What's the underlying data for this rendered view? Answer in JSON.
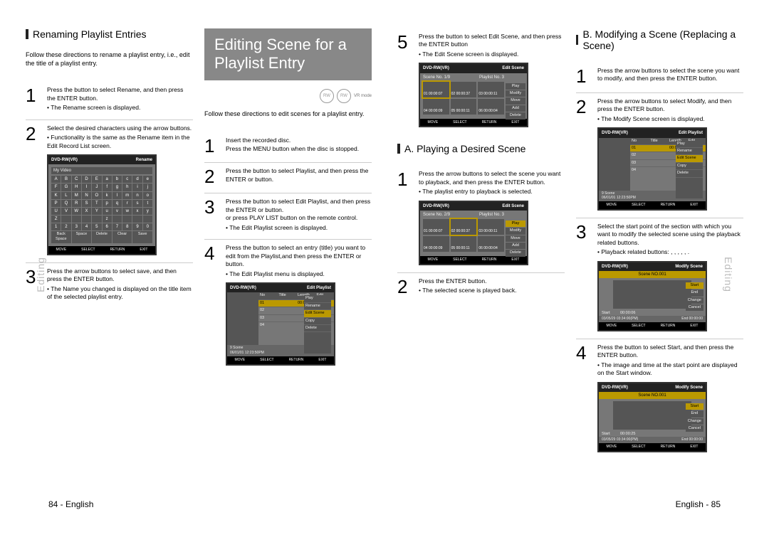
{
  "left": {
    "tab": "Editing",
    "h_rename": "Renaming Playlist Entries",
    "lead_rename": "Follow these directions to rename a playlist entry, i.e., edit the title of a playlist entry.",
    "s1": "Press the       button to select Rename, and then press the ENTER button.",
    "s1n": "The Rename screen is displayed.",
    "s2": "Select the desired characters using the arrow buttons.",
    "s2n": "Functionality is the same as the Rename item in the Edit Record List screen.",
    "s3": "Press the arrow buttons to select save, and then press the ENTER button.",
    "s3n": "The Name you changed is displayed on the title item of the selected playlist entry.",
    "shot_rename_title": "Rename",
    "shot_rename_disc": "DVD-RW(VR)",
    "shot_rename_field": "My Video",
    "kb_row": [
      "A",
      "B",
      "C",
      "D",
      "E",
      "a",
      "b",
      "c",
      "d",
      "e"
    ],
    "kb_row2": [
      "F",
      "G",
      "H",
      "I",
      "J",
      "f",
      "g",
      "h",
      "i",
      "j"
    ],
    "kb_row3": [
      "K",
      "L",
      "M",
      "N",
      "O",
      "k",
      "l",
      "m",
      "n",
      "o"
    ],
    "kb_row4": [
      "P",
      "Q",
      "R",
      "S",
      "T",
      "p",
      "q",
      "r",
      "s",
      "t"
    ],
    "kb_row5": [
      "U",
      "V",
      "W",
      "X",
      "Y",
      "u",
      "v",
      "w",
      "x",
      "y"
    ],
    "kb_row6": [
      "Z",
      " ",
      " ",
      " ",
      " ",
      "z",
      " ",
      " ",
      " ",
      " "
    ],
    "kb_nums": [
      "1",
      "2",
      "3",
      "4",
      "5",
      "6",
      "7",
      "8",
      "9",
      "0"
    ],
    "kb_fn": [
      "Back Space",
      "Space",
      "Delete",
      "Clear",
      "Save"
    ],
    "foot": [
      "MOVE",
      "SELECT",
      "RETURN",
      "EXIT"
    ],
    "bigtitle": "Editing Scene for a Playlist Entry",
    "vrmode": "VR mode",
    "lead_edit": "Follow these directions to edit scenes for a playlist entry.",
    "e1": "Insert the recorded disc.\nPress the MENU button when the disc is stopped.",
    "e2": "Press the       button to select Playlist, and then press the ENTER or  button.",
    "e3": "Press the       button to select Edit Playlist, and then press the ENTER or  button.\nor press PLAY LIST button on the remote control.",
    "e3n": "The Edit Playlist screen is displayed.",
    "e4": "Press the       button to select an entry (title) you want to edit from the Playlist,and then press the ENTER or  button.",
    "e4n": "The Edit Playlist menu is displayed.",
    "playlist": {
      "disc": "DVD-RW(VR)",
      "title": "Edit Playlist",
      "hdr": [
        "No",
        "Title",
        "Length",
        "Edit"
      ],
      "rows": [
        [
          "01",
          "",
          "00:00:07",
          ""
        ],
        [
          "02",
          "",
          "",
          ""
        ],
        [
          "03",
          "",
          "",
          ""
        ],
        [
          "04",
          "",
          "",
          ""
        ]
      ],
      "info": "9 Scene\n06/01/01 12:23:50PM",
      "menu": [
        "Play",
        "Rename",
        "Edit Scene",
        "Copy",
        "Delete"
      ]
    },
    "footer": "84 - English"
  },
  "right": {
    "tab": "Editing",
    "r5": "Press the       button to select Edit Scene, and then press the ENTER button",
    "r5n": "The Edit Scene screen is displayed.",
    "scene": {
      "disc": "DVD-RW(VR)",
      "title": "Edit Scene",
      "sceneno": "Scene No.    1/9",
      "playlist": "Playlist No.    3",
      "btns": [
        "Play",
        "Modify",
        "Move",
        "Add",
        "Delete"
      ],
      "cells": [
        {
          "no": "01",
          "t": "00:00:07"
        },
        {
          "no": "02",
          "t": "00:00:37"
        },
        {
          "no": "03",
          "t": "00:00:11"
        },
        {
          "no": "04",
          "t": "00:00:09"
        },
        {
          "no": "05",
          "t": "00:00:11"
        },
        {
          "no": "06",
          "t": "00:00:04"
        }
      ]
    },
    "hA": "A. Playing a Desired Scene",
    "a1": "Press the arrow buttons to select the scene you want to playback, and then press the ENTER button.",
    "a1n": "The playlist entry to playback is selected.",
    "sceneA": {
      "sceneno": "Scene No.    2/9",
      "playlist": "Playlist No.    3",
      "hlbtn": "Play"
    },
    "a2": "Press the ENTER button.",
    "a2n": "The selected scene is played back.",
    "hB": "B. Modifying a Scene (Replacing a Scene)",
    "b1": "Press the arrow buttons to select the scene you want to modify, and then press the ENTER button.",
    "b2": "Press the arrow buttons to select Modify, and then press the ENTER button.",
    "b2n": "The Modify Scene screen is displayed.",
    "playlistB": {
      "disc": "DVD-RW(VR)",
      "title": "Edit Playlist",
      "rows": [
        [
          "01",
          "",
          "00:00:07",
          ""
        ],
        [
          "02",
          "",
          "",
          ""
        ],
        [
          "03",
          "",
          "",
          ""
        ],
        [
          "04",
          "",
          "",
          ""
        ]
      ],
      "menu": [
        "Play",
        "Rename",
        "Edit Scene",
        "Copy",
        "Delete"
      ],
      "info": "9 Scene\n06/01/01 12:23:50PM"
    },
    "b3": "Select the start point of the section with which you want to modify the selected scene using the playback related buttons.",
    "b3n": "Playback related buttons:  ,  ,  ,  ,  ,  .",
    "modify1": {
      "disc": "DVD-RW(VR)",
      "title": "Modify Scene",
      "scn": "Scene NO.001",
      "start": "00:00:06",
      "end": "00:00:00",
      "date": "03/05/29 03:34:00(PM)",
      "btns": [
        "Start",
        "End",
        "Change",
        "Cancel"
      ]
    },
    "b4": "Press the       button to select Start, and then press the ENTER button.",
    "b4n": "The image and time at the start point are displayed on the Start window.",
    "modify2": {
      "start": "00:00:25",
      "end": "00:00:00"
    },
    "footer": "English - 85"
  }
}
